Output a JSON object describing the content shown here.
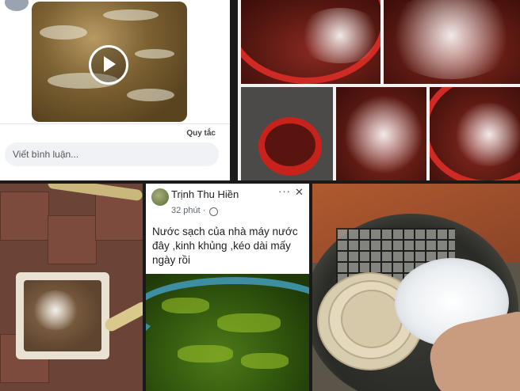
{
  "comment_panel": {
    "rules_link": "Quy tắc",
    "comment_placeholder": "Viết bình luận..."
  },
  "post": {
    "author": "Trịnh Thu Hiền",
    "time": "32 phút ·",
    "more_icon": "···",
    "close_icon": "✕",
    "text": "Nước sạch của nhà máy nước đây ,kinh khủng ,kéo dài mấy ngày rồi"
  },
  "colors": {
    "basin_red": "#d02a25",
    "murky_water": "#7d6233",
    "algae_green": "#33590e"
  }
}
